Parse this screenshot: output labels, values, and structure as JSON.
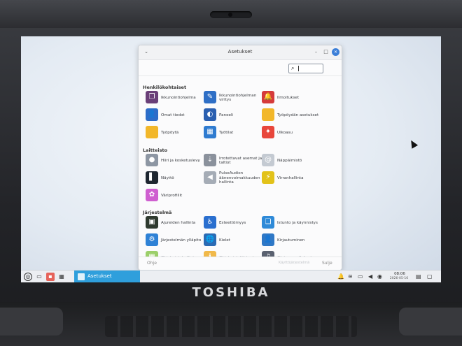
{
  "device": {
    "brand": "TOSHIBA"
  },
  "window": {
    "title": "Asetukset",
    "search_cursor": "|",
    "footer": {
      "help": "Ohje",
      "mid": "Käyttöjärjestelmä",
      "close": "Sulje"
    }
  },
  "sections": [
    {
      "title": "Henkilökohtaiset",
      "items": [
        {
          "label": "Ikkunointiohjelma",
          "icon": "window-manager-icon",
          "color": "#6a3f78",
          "glyph": "❐"
        },
        {
          "label": "Ikkunointiohjelman viritys",
          "icon": "window-tweaks-icon",
          "color": "#2f6fc6",
          "glyph": "✎"
        },
        {
          "label": "Ilmoitukset",
          "icon": "bell-icon",
          "color": "#d53b3b",
          "glyph": "🔔"
        },
        {
          "label": "Omat tiedot",
          "icon": "user-icon",
          "color": "#2d6cc8",
          "glyph": "👤"
        },
        {
          "label": "Paneeli",
          "icon": "panel-icon",
          "color": "#2a5fb0",
          "glyph": "◐"
        },
        {
          "label": "Työpöydän asetukset",
          "icon": "desktop-folder-icon",
          "color": "#f2b72a",
          "glyph": ""
        },
        {
          "label": "Työpöytä",
          "icon": "folder-icon",
          "color": "#f2b72a",
          "glyph": ""
        },
        {
          "label": "Työtilat",
          "icon": "workspaces-icon",
          "color": "#2f7bd0",
          "glyph": "▦"
        },
        {
          "label": "Ulkoasu",
          "icon": "appearance-icon",
          "color": "#e8463b",
          "glyph": "✦"
        }
      ]
    },
    {
      "title": "Laitteisto",
      "items": [
        {
          "label": "Hiiri ja kosketuslevy",
          "icon": "mouse-icon",
          "color": "#8d96a3",
          "glyph": "●"
        },
        {
          "label": "Irrotettavat asemat ja taltiot",
          "icon": "usb-icon",
          "color": "#8a919c",
          "glyph": "⇣"
        },
        {
          "label": "Näppäimistö",
          "icon": "keyboard-icon",
          "color": "#c4cad2",
          "glyph": "@"
        },
        {
          "label": "Näyttö",
          "icon": "display-icon",
          "color": "#1e2630",
          "glyph": "▌"
        },
        {
          "label": "PulseAudion äänenvoimakkuuden hallinta",
          "icon": "audio-icon",
          "color": "#a5acb6",
          "glyph": "◀"
        },
        {
          "label": "Virranhallinta",
          "icon": "power-icon",
          "color": "#e2c21a",
          "glyph": "⚡"
        },
        {
          "label": "Väriprofiilit",
          "icon": "color-profile-icon",
          "color": "#cf5fd0",
          "glyph": "✿"
        }
      ]
    },
    {
      "title": "Järjestelmä",
      "items": [
        {
          "label": "Ajureiden hallinta",
          "icon": "driver-icon",
          "color": "#2f3a2f",
          "glyph": "▣"
        },
        {
          "label": "Esteettömyys",
          "icon": "accessibility-icon",
          "color": "#2a6fcf",
          "glyph": "♿"
        },
        {
          "label": "Istunto ja käynnistys",
          "icon": "session-icon",
          "color": "#2e8ad8",
          "glyph": "❏"
        },
        {
          "label": "Järjestelmän ylläpito",
          "icon": "maintenance-icon",
          "color": "#2f82d6",
          "glyph": "⚙"
        },
        {
          "label": "Kielet",
          "icon": "language-icon",
          "color": "#2b6bb4",
          "glyph": "🌐"
        },
        {
          "label": "Kirjautuminen",
          "icon": "login-icon",
          "color": "#2f78c6",
          "glyph": "👤"
        },
        {
          "label": "Ohjelmistohallinta",
          "icon": "software-manager-icon",
          "color": "#9ccf6a",
          "glyph": "▦",
          "dim": true
        },
        {
          "label": "Ohjelmistolähteet",
          "icon": "software-sources-icon",
          "color": "#f1b94a",
          "glyph": "ℹ",
          "dim": true
        },
        {
          "label": "Oletussovellukset",
          "icon": "default-apps-icon",
          "color": "#5a6170",
          "glyph": "♫",
          "dim": true
        }
      ]
    }
  ],
  "taskbar": {
    "task_label": "Asetukset",
    "time": "08:06",
    "date": "2026-05-16"
  }
}
